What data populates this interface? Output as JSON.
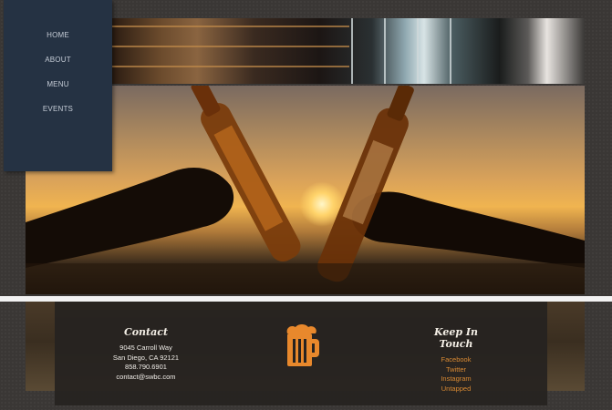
{
  "nav": {
    "items": [
      {
        "label": "HOME"
      },
      {
        "label": "ABOUT"
      },
      {
        "label": "MENU"
      },
      {
        "label": "EVENTS"
      }
    ]
  },
  "footer": {
    "contact": {
      "heading": "Contact",
      "address_line1": "9045 Carroll Way",
      "address_line2": "San Diego, CA 92121",
      "phone": "858.790.6901",
      "email": "contact@swbc.com"
    },
    "logo_icon": "beer-mug-icon",
    "social": {
      "heading": "Keep In Touch",
      "links": [
        {
          "label": "Facebook"
        },
        {
          "label": "Twitter"
        },
        {
          "label": "Instagram"
        },
        {
          "label": "Untapped"
        }
      ]
    }
  },
  "colors": {
    "sidebar_bg": "#253243",
    "link_accent": "#d98a33",
    "logo_orange": "#e8882c"
  }
}
